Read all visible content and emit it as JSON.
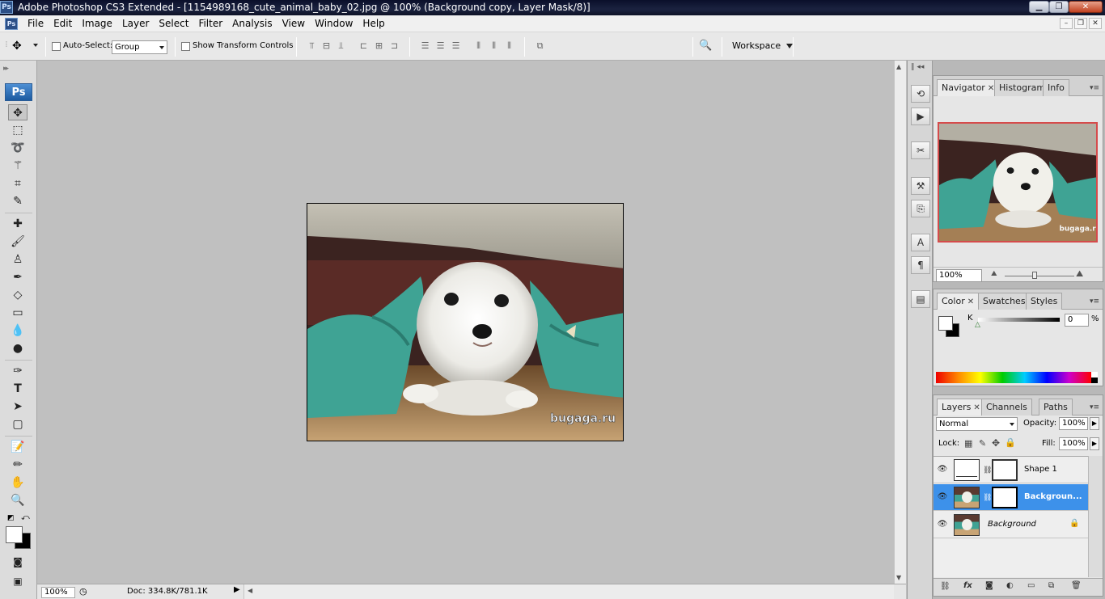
{
  "titlebar": {
    "title": "Adobe Photoshop CS3 Extended - [1154989168_cute_animal_baby_02.jpg @ 100% (Background copy, Layer Mask/8)]",
    "logo": "Ps",
    "minimize": "▁",
    "restore": "❐",
    "close": "✕"
  },
  "menubar": {
    "items": [
      "File",
      "Edit",
      "Image",
      "Layer",
      "Select",
      "Filter",
      "Analysis",
      "View",
      "Window",
      "Help"
    ],
    "mdi_minimize": "–",
    "mdi_restore": "❐",
    "mdi_close": "✕"
  },
  "options": {
    "auto_select_label": "Auto-Select:",
    "auto_select_value": "Group",
    "show_transform_label": "Show Transform Controls",
    "workspace_label": "Workspace"
  },
  "toolbar": {
    "logo": "Ps"
  },
  "canvas": {
    "watermark": "bugaga.ru",
    "colors": {
      "canvas_bg": "#c0c0c0",
      "towel": "#3fa394",
      "puppy": "#f1f0ea"
    }
  },
  "status": {
    "zoom": "100%",
    "doc": "Doc: 334.8K/781.1K"
  },
  "navigator": {
    "tabs": [
      "Navigator",
      "Histogram",
      "Info"
    ],
    "zoom": "100%",
    "frame_color": "#d54b4b"
  },
  "color_panel": {
    "tabs": [
      "Color",
      "Swatches",
      "Styles"
    ],
    "channel_label": "K",
    "channel_value": "0",
    "unit": "%"
  },
  "layers": {
    "tabs": [
      "Layers",
      "Channels",
      "Paths"
    ],
    "blend_mode": "Normal",
    "opacity_label": "Opacity:",
    "opacity_value": "100%",
    "lock_label": "Lock:",
    "fill_label": "Fill:",
    "fill_value": "100%",
    "rows": [
      {
        "name": "Shape 1",
        "selected": false
      },
      {
        "name": "Backgroun...",
        "selected": true
      },
      {
        "name": "Background",
        "selected": false
      }
    ],
    "selection_color": "#3d91ea"
  }
}
